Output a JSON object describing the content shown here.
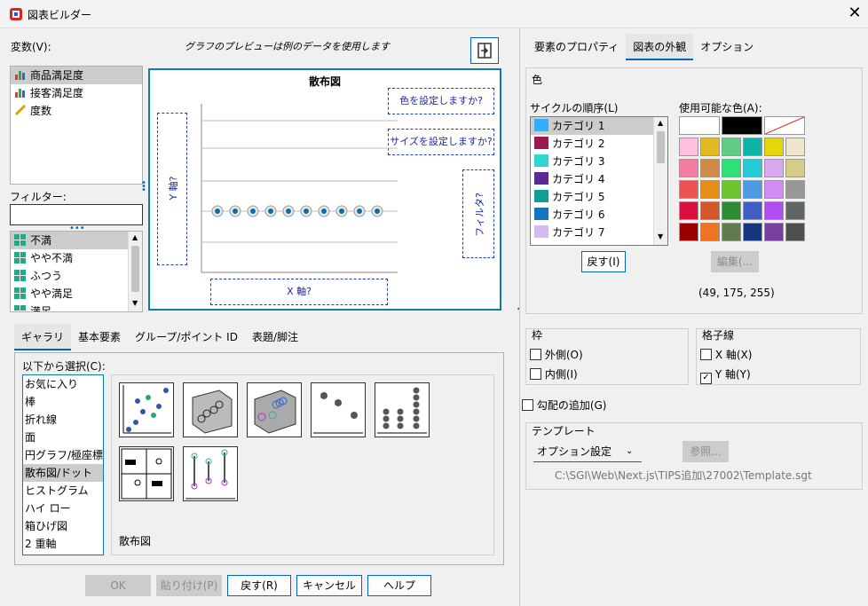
{
  "window": {
    "title": "図表ビルダー",
    "close_glyph": "✕"
  },
  "left": {
    "variables_label": "変数(V):",
    "preview_note": "グラフのプレビューは例のデータを使用します",
    "variables": [
      {
        "label": "商品満足度",
        "icon": "bar-chart-icon",
        "selected": true
      },
      {
        "label": "接客満足度",
        "icon": "bar-chart-icon",
        "selected": false
      },
      {
        "label": "度数",
        "icon": "ruler-icon",
        "selected": false
      }
    ],
    "filter_label": "フィルター:",
    "categories": [
      {
        "label": "不満",
        "selected": true
      },
      {
        "label": "やや不満",
        "selected": false
      },
      {
        "label": "ふつう",
        "selected": false
      },
      {
        "label": "やや満足",
        "selected": false
      },
      {
        "label": "満足",
        "selected": false
      }
    ],
    "canvas": {
      "title": "散布図",
      "color_drop": "色を設定しますか?",
      "size_drop": "サイズを設定しますか?",
      "y_drop": "Y 軸?",
      "x_drop": "X 軸?",
      "filter_drop": "フィルタ?"
    },
    "tabs": [
      "ギャラリ",
      "基本要素",
      "グループ/ポイント ID",
      "表題/脚注"
    ],
    "choose_label": "以下から選択(C):",
    "chart_types": [
      "お気に入り",
      "棒",
      "折れ線",
      "面",
      "円グラフ/極座標",
      "散布図/ドット",
      "ヒストグラム",
      "ハイ ロー",
      "箱ひげ図",
      "2 重軸"
    ],
    "selected_chart_type": "散布図/ドット",
    "gallery_caption": "散布図",
    "buttons": {
      "ok": "OK",
      "paste": "貼り付け(P)",
      "reset": "戻す(R)",
      "cancel": "キャンセル",
      "help": "ヘルプ"
    }
  },
  "right": {
    "tabs": [
      "要素のプロパティ",
      "図表の外観",
      "オプション"
    ],
    "active_tab": "図表の外観",
    "color_group": "色",
    "cycle_label": "サイクルの順序(L)",
    "cycle_items": [
      {
        "label": "カテゴリ 1",
        "color": "#31AFFF"
      },
      {
        "label": "カテゴリ 2",
        "color": "#9B1A4D"
      },
      {
        "label": "カテゴリ 3",
        "color": "#2ED6D0"
      },
      {
        "label": "カテゴリ 4",
        "color": "#5B2898"
      },
      {
        "label": "カテゴリ 5",
        "color": "#0E9E97"
      },
      {
        "label": "カテゴリ 6",
        "color": "#1673C4"
      },
      {
        "label": "カテゴリ 7",
        "color": "#D7B9F2"
      }
    ],
    "reset_button": "戻す(I)",
    "available_label": "使用可能な色(A):",
    "palette": [
      "#FFFFFF",
      "#000000",
      "none",
      "#FFBFDF",
      "#E3B820",
      "#5FCB86",
      "#0DB3A6",
      "#E3D70B",
      "#EFE7CC",
      "#F37D9E",
      "#CD8B45",
      "#2FE07A",
      "#23CBD7",
      "#D9A8EC",
      "#D7CB88",
      "#EC5454",
      "#E68F15",
      "#6EC42C",
      "#4C9AE6",
      "#D28BF2",
      "#979797",
      "#DB0F3D",
      "#D45727",
      "#2D8B34",
      "#3F5EC2",
      "#B04DF2",
      "#5F6560",
      "#9B0000",
      "#F07324",
      "#617A4F",
      "#15357D",
      "#7A3E9E",
      "#4F4F4F"
    ],
    "edit_button": "編集(...",
    "rgb": "(49, 175, 255)",
    "frame_group": "枠",
    "frame_outer": "外側(O)",
    "frame_inner": "内側(I)",
    "grid_group": "格子線",
    "grid_x": "X 軸(X)",
    "grid_y": "Y 軸(Y)",
    "gradient": "勾配の追加(G)",
    "template_group": "テンプレート",
    "template_select": "オプション設定",
    "browse_button": "参照...",
    "template_path": "C:\\SGI\\Web\\Next.js\\TIPS追加\\27002\\Template.sgt"
  }
}
